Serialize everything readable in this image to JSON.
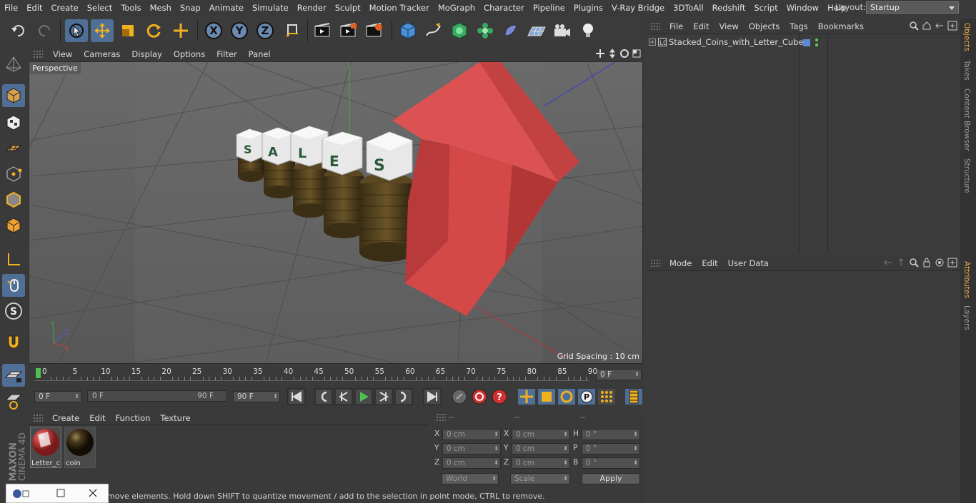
{
  "menubar": {
    "items": [
      "File",
      "Edit",
      "Create",
      "Select",
      "Tools",
      "Mesh",
      "Snap",
      "Animate",
      "Simulate",
      "Render",
      "Sculpt",
      "Motion Tracker",
      "MoGraph",
      "Character",
      "Pipeline",
      "Plugins",
      "V-Ray Bridge",
      "3DToAll",
      "Redshift",
      "Script",
      "Window",
      "Help"
    ],
    "layout_label": "Layout:",
    "layout_value": "Startup"
  },
  "viewport": {
    "menu": [
      "View",
      "Cameras",
      "Display",
      "Options",
      "Filter",
      "Panel"
    ],
    "camera_label": "Perspective",
    "grid_spacing": "Grid Spacing : 10 cm",
    "letters": [
      "S",
      "A",
      "L",
      "E",
      "S"
    ],
    "axes": {
      "y": "Y",
      "z": "Z",
      "x": "X"
    }
  },
  "timeline": {
    "ticks": [
      "0",
      "5",
      "10",
      "15",
      "20",
      "25",
      "30",
      "35",
      "40",
      "45",
      "50",
      "55",
      "60",
      "65",
      "70",
      "75",
      "80",
      "85",
      "90"
    ],
    "current_frame": "0 F"
  },
  "controls": {
    "start": "0 F",
    "range_start": "0 F",
    "range_end": "90 F",
    "end": "90 F"
  },
  "materials": {
    "menu": [
      "Create",
      "Edit",
      "Function",
      "Texture"
    ],
    "items": [
      {
        "name": "Letter_cu",
        "color": "#c83a3a"
      },
      {
        "name": "coin",
        "color": "#4a3a1c"
      }
    ]
  },
  "coordinates": {
    "headers": [
      "--",
      "--",
      "--"
    ],
    "rows": [
      {
        "a": "X",
        "av": "0 cm",
        "b": "X",
        "bv": "0 cm",
        "c": "H",
        "cv": "0 °"
      },
      {
        "a": "Y",
        "av": "0 cm",
        "b": "Y",
        "bv": "0 cm",
        "c": "P",
        "cv": "0 °"
      },
      {
        "a": "Z",
        "av": "0 cm",
        "b": "Z",
        "bv": "0 cm",
        "c": "B",
        "cv": "0 °"
      }
    ],
    "mode": "World",
    "scale": "Scale",
    "apply": "Apply"
  },
  "status_text": "move elements. Hold down SHIFT to quantize movement / add to the selection in point mode, CTRL to remove.",
  "objects": {
    "menu": [
      "File",
      "Edit",
      "View",
      "Objects",
      "Tags",
      "Bookmarks"
    ],
    "items": [
      {
        "name": "Stacked_Coins_with_Letter_Cubes"
      }
    ]
  },
  "attributes": {
    "menu": [
      "Mode",
      "Edit",
      "User Data"
    ]
  },
  "right_tabs": [
    "Objects",
    "Takes",
    "Content Browser",
    "Structure",
    "Attributes",
    "Layers"
  ],
  "branding": {
    "line1": "MAXON",
    "line2": "CINEMA 4D"
  }
}
